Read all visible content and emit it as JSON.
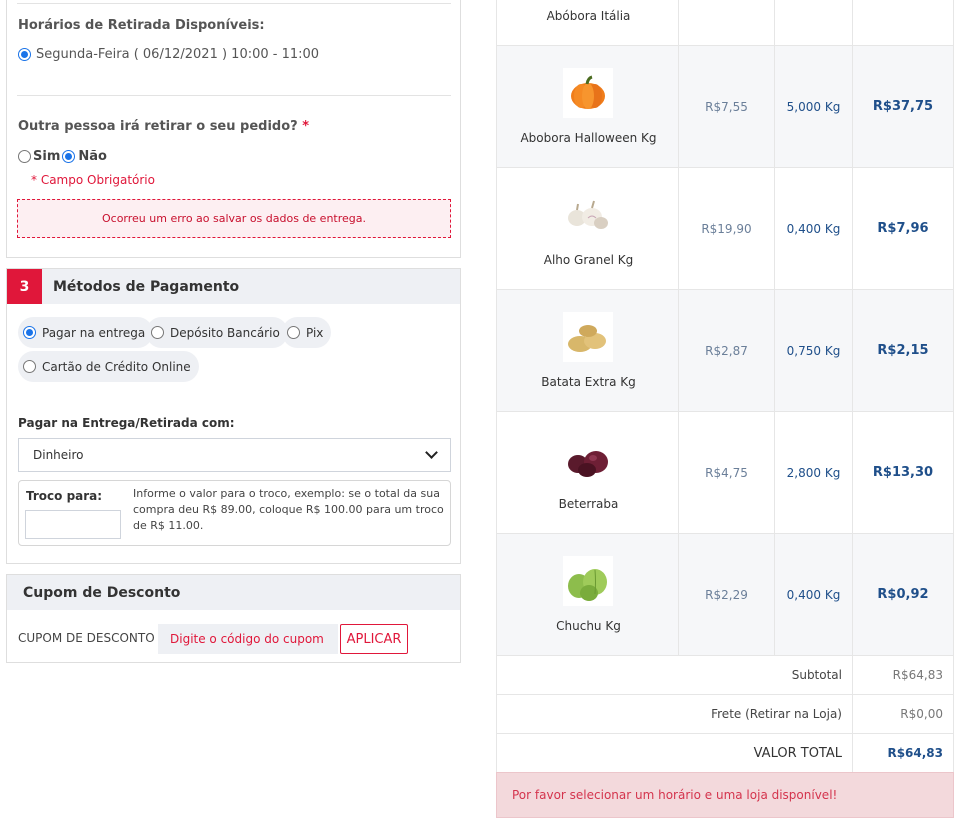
{
  "delivery": {
    "pickup_label": "Horários de Retirada Disponíveis:",
    "pickup_option": "Segunda-Feira ( 06/12/2021 ) 10:00 - 11:00",
    "other_person_question": "Outra pessoa irá retirar o seu pedido?",
    "required_mark": "*",
    "option_yes": "Sim",
    "option_no": "Não",
    "required_field": "Campo Obrigatório",
    "save_error": "Ocorreu um erro ao salvar os dados de entrega."
  },
  "payment": {
    "step_number": "3",
    "title": "Métodos de Pagamento",
    "methods": [
      "Pagar na entrega",
      "Depósito Bancário",
      "Pix",
      "Cartão de Crédito Online"
    ],
    "selected_method": "Pagar na entrega",
    "pay_with_label": "Pagar na Entrega/Retirada com:",
    "pay_with_value": "Dinheiro",
    "change_label": "Troco para:",
    "change_value": "",
    "change_help": "Informe o valor para o troco, exemplo: se o total da sua compra deu R$ 89.00, coloque R$ 100.00 para um troco de R$ 11.00."
  },
  "coupon": {
    "title": "Cupom de Desconto",
    "label": "CUPOM DE DESCONTO",
    "placeholder": "Digite o código do cupom",
    "apply_label": "APLICAR"
  },
  "cart": {
    "items": [
      {
        "name": "Abóbora Itália",
        "price": "",
        "qty": "",
        "total": "",
        "icon": "pumpkin-italia-icon"
      },
      {
        "name": "Abobora Halloween Kg",
        "price": "R$7,55",
        "qty": "5,000 Kg",
        "total": "R$37,75",
        "icon": "pumpkin-icon"
      },
      {
        "name": "Alho Granel Kg",
        "price": "R$19,90",
        "qty": "0,400 Kg",
        "total": "R$7,96",
        "icon": "garlic-icon"
      },
      {
        "name": "Batata Extra Kg",
        "price": "R$2,87",
        "qty": "0,750 Kg",
        "total": "R$2,15",
        "icon": "potato-icon"
      },
      {
        "name": "Beterraba",
        "price": "R$4,75",
        "qty": "2,800 Kg",
        "total": "R$13,30",
        "icon": "beet-icon"
      },
      {
        "name": "Chuchu Kg",
        "price": "R$2,29",
        "qty": "0,400 Kg",
        "total": "R$0,92",
        "icon": "chayote-icon"
      }
    ],
    "subtotal_label": "Subtotal",
    "subtotal_value": "R$64,83",
    "shipping_label": "Frete (Retirar na Loja)",
    "shipping_value": "R$0,00",
    "total_label": "VALOR TOTAL",
    "total_value": "R$64,83",
    "alert": "Por favor selecionar um horário e uma loja disponível!"
  },
  "colors": {
    "accent_red": "#e0173a",
    "price_blue": "#1f4f8a",
    "radio_blue": "#1a73e8"
  }
}
